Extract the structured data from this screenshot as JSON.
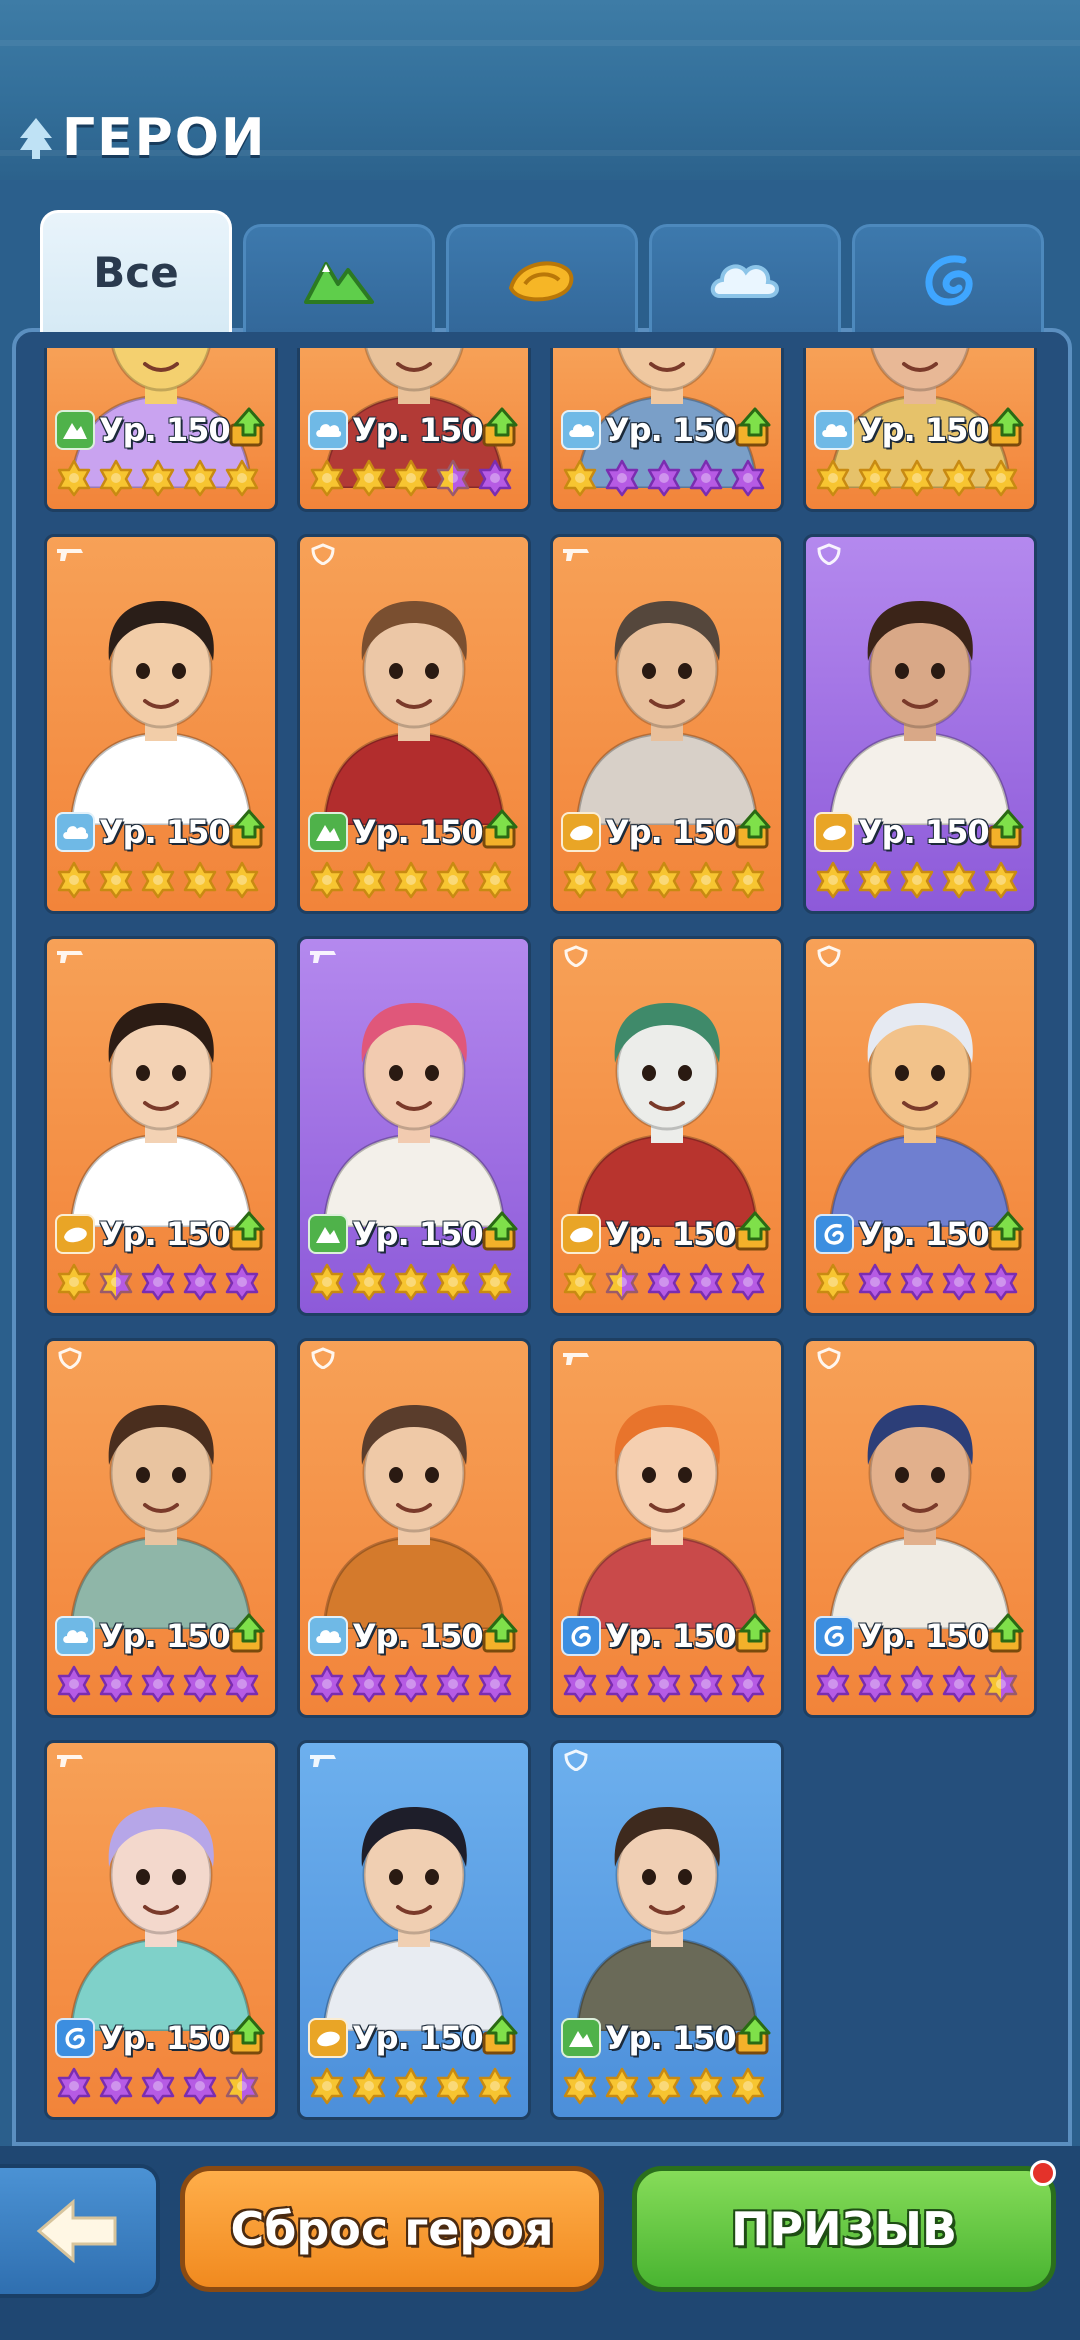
{
  "header": {
    "title": "ГЕРОИ"
  },
  "tabs": [
    {
      "label": "Все",
      "icon": "all"
    },
    {
      "label": "",
      "icon": "forest-icon"
    },
    {
      "label": "",
      "icon": "desert-icon"
    },
    {
      "label": "",
      "icon": "cloud-icon"
    },
    {
      "label": "",
      "icon": "water-icon"
    }
  ],
  "colors": {
    "orange_card": "#f2843a",
    "purple_card": "#8d5ad9",
    "blue_card": "#4c8fda",
    "gold_star": "#f7c531",
    "purple_star": "#b65be4"
  },
  "heroes": [
    {
      "level": "Ур. 150",
      "element": "forest",
      "role": "none",
      "card": "orange",
      "stars": [
        "g",
        "g",
        "g",
        "g",
        "g"
      ],
      "partial": true
    },
    {
      "level": "Ур. 150",
      "element": "cloud",
      "role": "none",
      "card": "orange",
      "stars": [
        "g",
        "g",
        "g",
        "h",
        "p"
      ],
      "partial": true
    },
    {
      "level": "Ур. 150",
      "element": "cloud",
      "role": "none",
      "card": "orange",
      "stars": [
        "g",
        "p",
        "p",
        "p",
        "p"
      ],
      "partial": true
    },
    {
      "level": "Ур. 150",
      "element": "cloud",
      "role": "none",
      "card": "orange",
      "stars": [
        "g",
        "g",
        "g",
        "g",
        "g"
      ],
      "partial": true
    },
    {
      "level": "Ур. 150",
      "element": "cloud",
      "role": "gun",
      "card": "orange",
      "stars": [
        "g",
        "g",
        "g",
        "g",
        "g"
      ]
    },
    {
      "level": "Ур. 150",
      "element": "forest",
      "role": "shield",
      "card": "orange",
      "stars": [
        "g",
        "g",
        "g",
        "g",
        "g"
      ]
    },
    {
      "level": "Ур. 150",
      "element": "desert",
      "role": "gun",
      "card": "orange",
      "stars": [
        "g",
        "g",
        "g",
        "g",
        "g"
      ]
    },
    {
      "level": "Ур. 150",
      "element": "desert",
      "role": "shield",
      "card": "purple",
      "stars": [
        "g",
        "g",
        "g",
        "g",
        "g"
      ]
    },
    {
      "level": "Ур. 150",
      "element": "desert",
      "role": "gun",
      "card": "orange",
      "stars": [
        "g",
        "h",
        "p",
        "p",
        "p"
      ]
    },
    {
      "level": "Ур. 150",
      "element": "forest",
      "role": "gun",
      "card": "purple",
      "stars": [
        "g",
        "g",
        "g",
        "g",
        "g"
      ]
    },
    {
      "level": "Ур. 150",
      "element": "desert",
      "role": "shield",
      "card": "orange",
      "stars": [
        "g",
        "h",
        "p",
        "p",
        "p"
      ]
    },
    {
      "level": "Ур. 150",
      "element": "water",
      "role": "shield",
      "card": "orange",
      "stars": [
        "g",
        "p",
        "p",
        "p",
        "p"
      ]
    },
    {
      "level": "Ур. 150",
      "element": "cloud",
      "role": "shield",
      "card": "orange",
      "stars": [
        "p",
        "p",
        "p",
        "p",
        "p"
      ]
    },
    {
      "level": "Ур. 150",
      "element": "cloud",
      "role": "shield",
      "card": "orange",
      "stars": [
        "p",
        "p",
        "p",
        "p",
        "p"
      ]
    },
    {
      "level": "Ур. 150",
      "element": "water",
      "role": "gun",
      "card": "orange",
      "stars": [
        "p",
        "p",
        "p",
        "p",
        "p"
      ]
    },
    {
      "level": "Ур. 150",
      "element": "water",
      "role": "shield",
      "card": "orange",
      "stars": [
        "p",
        "p",
        "p",
        "p",
        "h"
      ]
    },
    {
      "level": "Ур. 150",
      "element": "water",
      "role": "gun",
      "card": "orange",
      "stars": [
        "p",
        "p",
        "p",
        "p",
        "h"
      ]
    },
    {
      "level": "Ур. 150",
      "element": "desert",
      "role": "gun",
      "card": "blue",
      "stars": [
        "g",
        "g",
        "g",
        "g",
        "g"
      ]
    },
    {
      "level": "Ур. 150",
      "element": "forest",
      "role": "shield",
      "card": "blue",
      "stars": [
        "g",
        "g",
        "g",
        "g",
        "g"
      ]
    }
  ],
  "footer": {
    "reset_label": "Сброс героя",
    "summon_label": "ПРИЗЫВ"
  }
}
